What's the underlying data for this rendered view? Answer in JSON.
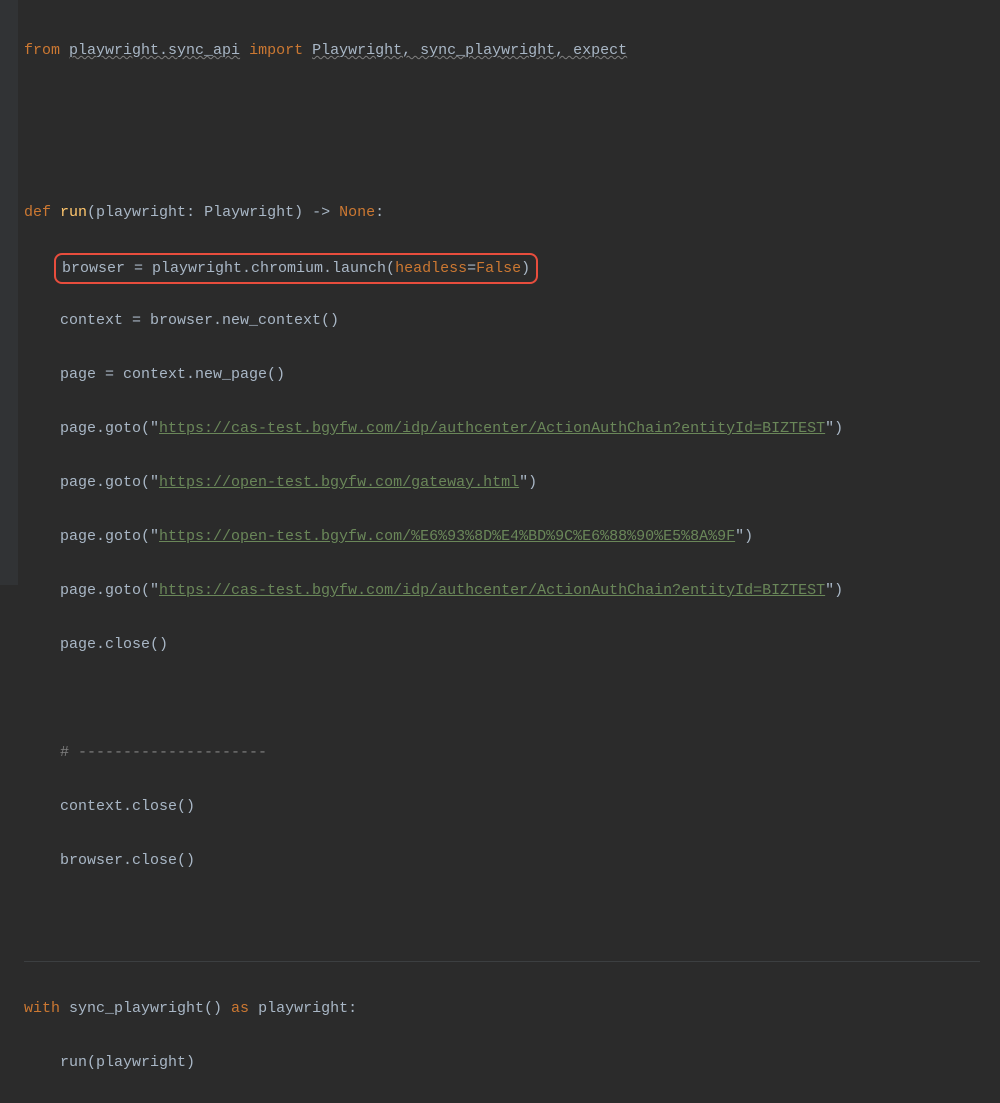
{
  "lines": {
    "import_from": "from",
    "import_mod": "playwright.sync_api",
    "import_kw": "import",
    "import_names": "Playwright, sync_playwright, expect",
    "def_kw": "def",
    "def_name": "run",
    "def_sig_open": "(playwright: Playwright) -> ",
    "def_none": "None",
    "def_sig_close": ":",
    "l_browser_a": "browser = playwright.chromium.launch(",
    "l_browser_kw": "headless",
    "l_browser_b": "=",
    "l_browser_false": "False",
    "l_browser_c": ")",
    "l_context": "context = browser.new_context()",
    "l_page": "page = context.new_page()",
    "l_goto1_a": "page.goto(",
    "l_goto1_q": "\"",
    "l_goto1_url": "https://cas-test.bgyfw.com/idp/authcenter/ActionAuthChain?entityId=BIZTEST",
    "l_goto1_c": ")",
    "l_goto2_a": "page.goto(",
    "l_goto2_url": "https://open-test.bgyfw.com/gateway.html",
    "l_goto2_c": ")",
    "l_goto3_a": "page.goto(",
    "l_goto3_url": "https://open-test.bgyfw.com/%E6%93%8D%E4%BD%9C%E6%88%90%E5%8A%9F",
    "l_goto3_c": ")",
    "l_goto4_a": "page.goto(",
    "l_goto4_url": "https://cas-test.bgyfw.com/idp/authcenter/ActionAuthChain?entityId=BIZTEST",
    "l_goto4_c": ")",
    "l_pageclose": "page.close()",
    "l_comment": "# ---------------------",
    "l_ctxclose": "context.close()",
    "l_brclose": "browser.close()",
    "with_kw": "with",
    "with_call": " sync_playwright() ",
    "with_as": "as",
    "with_var": " playwright:",
    "with_body": "run(playwright)"
  }
}
